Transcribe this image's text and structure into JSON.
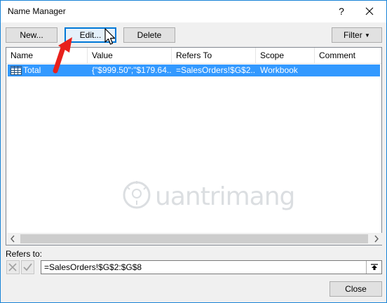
{
  "window": {
    "title": "Name Manager",
    "help_label": "?"
  },
  "toolbar": {
    "new_label": "New...",
    "edit_label": "Edit...",
    "delete_label": "Delete",
    "filter_label": "Filter"
  },
  "list": {
    "columns": [
      "Name",
      "Value",
      "Refers To",
      "Scope",
      "Comment"
    ],
    "rows": [
      {
        "name": "Total",
        "value": "{\"$999.50\";\"$179.64...",
        "refers_to": "=SalesOrders!$G$2...",
        "scope": "Workbook",
        "comment": ""
      }
    ]
  },
  "watermark": {
    "text": "uantrimang"
  },
  "refers_to": {
    "label": "Refers to:",
    "value": "=SalesOrders!$G$2:$G$8"
  },
  "footer": {
    "close_label": "Close"
  },
  "colors": {
    "selection": "#3399ff",
    "accent": "#0078d7",
    "arrow": "#e8211c"
  }
}
